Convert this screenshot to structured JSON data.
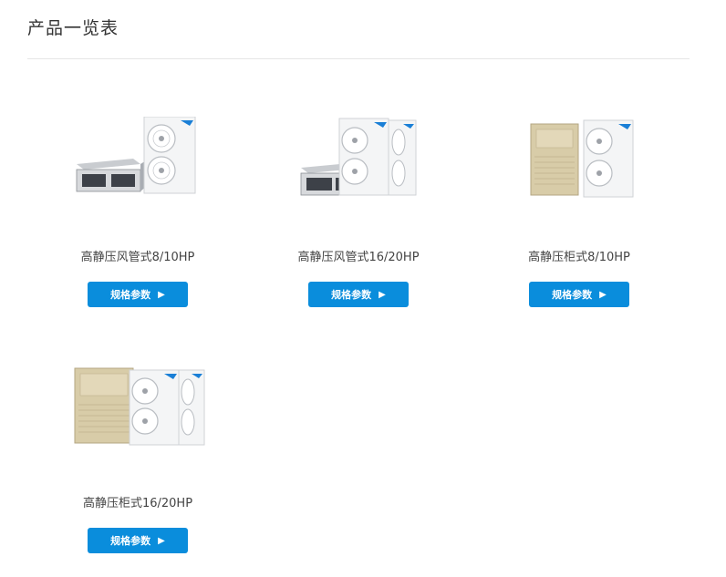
{
  "page_title": "产品一览表",
  "button_arrow": "▶",
  "products": [
    {
      "name": "高静压风管式8/10HP",
      "button_label": "规格参数"
    },
    {
      "name": "高静压风管式16/20HP",
      "button_label": "规格参数"
    },
    {
      "name": "高静压柜式8/10HP",
      "button_label": "规格参数"
    },
    {
      "name": "高静压柜式16/20HP",
      "button_label": "规格参数"
    }
  ],
  "colors": {
    "button": "#0a8ddc",
    "outdoor_unit": "#f4f5f6",
    "cabinet": "#d8cca8",
    "duct_unit": "#5a5f66",
    "brand_accent": "#1a7fd6"
  }
}
